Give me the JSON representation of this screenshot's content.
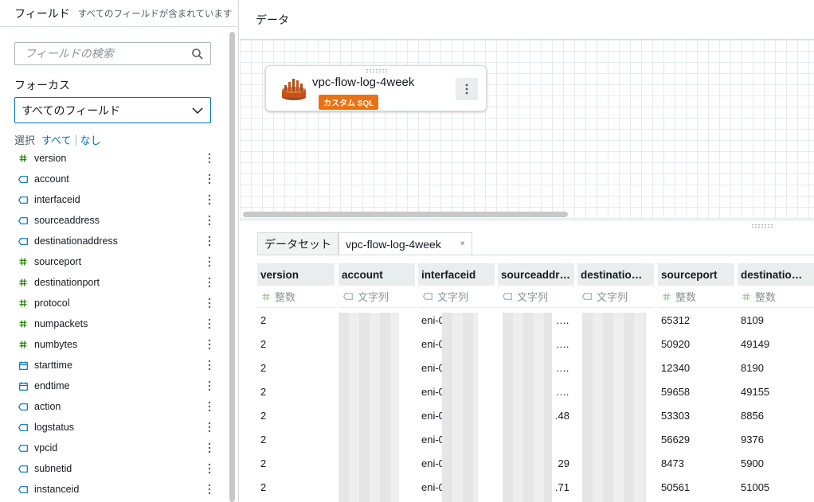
{
  "left": {
    "title": "フィールド",
    "subtitle": "すべてのフィールドが含まれています",
    "search_placeholder": "フィールドの検索",
    "focus_label": "フォーカス",
    "focus_value": "すべてのフィールド",
    "select_label": "選択",
    "select_all": "すべて",
    "select_none": "なし",
    "fields": [
      {
        "name": "version",
        "type": "number"
      },
      {
        "name": "account",
        "type": "string"
      },
      {
        "name": "interfaceid",
        "type": "string"
      },
      {
        "name": "sourceaddress",
        "type": "string"
      },
      {
        "name": "destinationaddress",
        "type": "string"
      },
      {
        "name": "sourceport",
        "type": "number"
      },
      {
        "name": "destinationport",
        "type": "number"
      },
      {
        "name": "protocol",
        "type": "number"
      },
      {
        "name": "numpackets",
        "type": "number"
      },
      {
        "name": "numbytes",
        "type": "number"
      },
      {
        "name": "starttime",
        "type": "date"
      },
      {
        "name": "endtime",
        "type": "date"
      },
      {
        "name": "action",
        "type": "string"
      },
      {
        "name": "logstatus",
        "type": "string"
      },
      {
        "name": "vpcid",
        "type": "string"
      },
      {
        "name": "subnetid",
        "type": "string"
      },
      {
        "name": "instanceid",
        "type": "string"
      }
    ]
  },
  "right": {
    "header": "データ",
    "node_title": "vpc-flow-log-4week",
    "node_badge": "カスタム SQL",
    "tabs": [
      "データセット",
      "vpc-flow-log-4week"
    ],
    "columns": [
      {
        "head": "version",
        "type": "整数",
        "kind": "number",
        "cells": [
          "2",
          "2",
          "2",
          "2",
          "2",
          "2",
          "2",
          "2"
        ]
      },
      {
        "head": "account",
        "type": "文字列",
        "kind": "string",
        "cells": [
          "",
          "",
          "",
          "",
          "",
          "",
          "",
          ""
        ]
      },
      {
        "head": "interfaceid",
        "type": "文字列",
        "kind": "string",
        "cells": [
          "eni-0",
          "eni-0",
          "eni-0",
          "eni-0",
          "eni-0",
          "eni-0",
          "eni-0",
          "eni-0"
        ]
      },
      {
        "head": "sourceaddr…",
        "type": "文字列",
        "kind": "string",
        "cells": [
          ".…",
          ".…",
          ".…",
          ".…",
          ".48",
          "",
          "29",
          ".71"
        ]
      },
      {
        "head": "destinatio…",
        "type": "文字列",
        "kind": "string",
        "cells": [
          "",
          "",
          "",
          "",
          "",
          "",
          "",
          ""
        ]
      },
      {
        "head": "sourceport",
        "type": "整数",
        "kind": "number",
        "cells": [
          "65312",
          "50920",
          "12340",
          "59658",
          "53303",
          "56629",
          "8473",
          "50561"
        ]
      },
      {
        "head": "destinatio…",
        "type": "整数",
        "kind": "number",
        "cells": [
          "8109",
          "49149",
          "8190",
          "49155",
          "8856",
          "9376",
          "5900",
          "51005"
        ]
      }
    ]
  }
}
